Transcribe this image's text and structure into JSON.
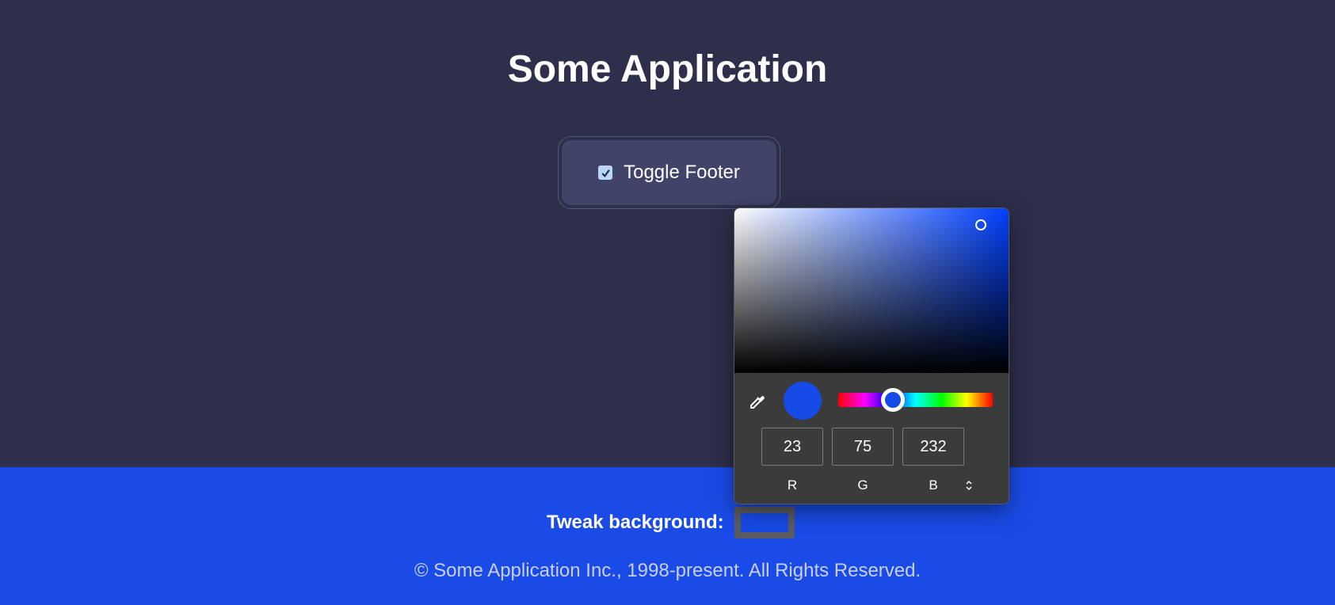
{
  "header": {
    "title": "Some Application"
  },
  "toggle": {
    "label": "Toggle Footer",
    "checked": true
  },
  "footer": {
    "tweak_label": "Tweak background:",
    "copyright": "© Some Application Inc., 1998-present. All Rights Reserved."
  },
  "picker": {
    "color_hex": "#174be8",
    "hue_base_hex": "#0040ff",
    "hue_fraction": 0.355,
    "saturation": 0.9,
    "brightness": 0.9,
    "rgb": {
      "r": "23",
      "g": "75",
      "b": "232"
    },
    "labels": {
      "r": "R",
      "g": "G",
      "b": "B"
    },
    "icons": {
      "eyedropper": "eyedropper-icon",
      "mode_switch": "up-down-chevron-icon"
    }
  },
  "colors": {
    "page_background": "#2e2f4b",
    "button_background": "#414369",
    "footer_background": "#1a4be7"
  }
}
